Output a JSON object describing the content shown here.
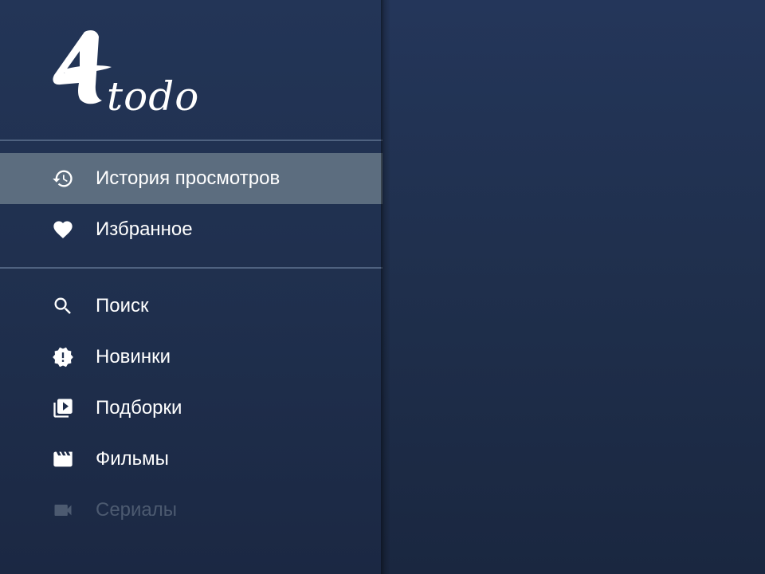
{
  "app": {
    "logo_text": "todo",
    "logo_glyph": "4"
  },
  "menu": {
    "group1": [
      {
        "id": "history",
        "label": "История просмотров",
        "icon": "history-icon",
        "active": true
      },
      {
        "id": "favorites",
        "label": "Избранное",
        "icon": "heart-icon",
        "active": false
      }
    ],
    "group2": [
      {
        "id": "search",
        "label": "Поиск",
        "icon": "search-icon",
        "active": false
      },
      {
        "id": "new",
        "label": "Новинки",
        "icon": "new-badge-icon",
        "active": false
      },
      {
        "id": "collections",
        "label": "Подборки",
        "icon": "playlist-play-icon",
        "active": false
      },
      {
        "id": "movies",
        "label": "Фильмы",
        "icon": "movie-icon",
        "active": false
      },
      {
        "id": "series",
        "label": "Сериалы",
        "icon": "videocam-icon",
        "active": false,
        "dimmed": true
      }
    ]
  },
  "colors": {
    "background": "#1f2f4c",
    "active_item": "#5c6d7f",
    "divider": "#4f6280",
    "text": "#ffffff",
    "dimmed_text": "#4c5a70"
  }
}
